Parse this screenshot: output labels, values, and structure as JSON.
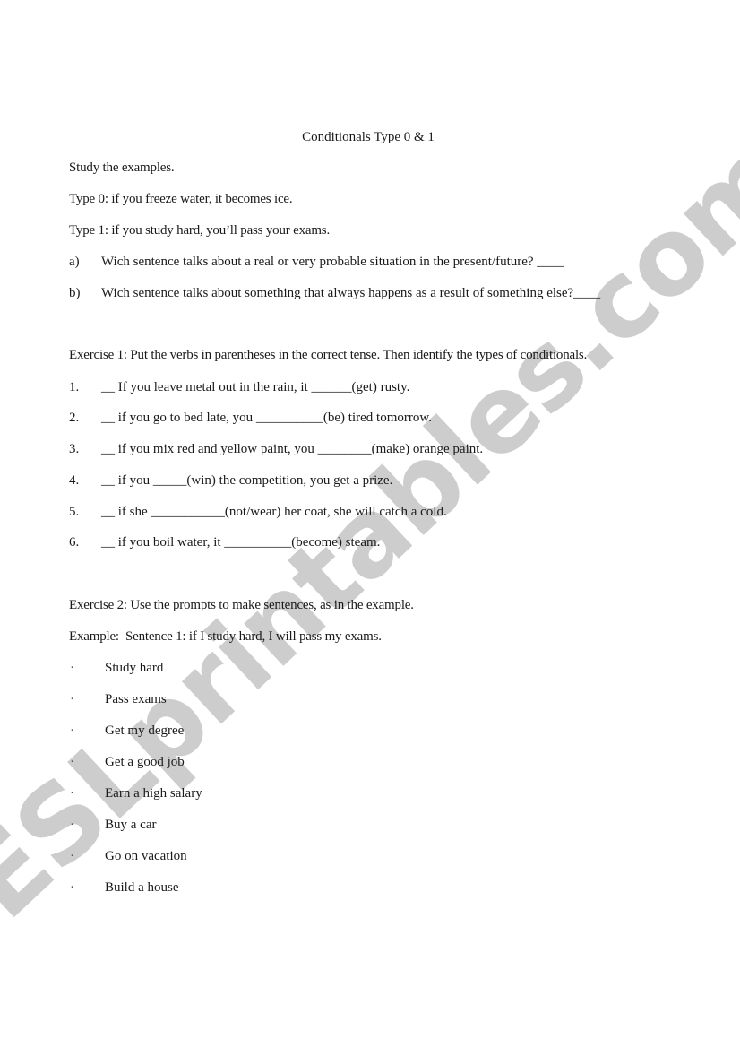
{
  "watermark": "ESLprintables.com",
  "title": "Conditionals Type 0 & 1",
  "intro": {
    "instruction": "Study the examples.",
    "type0": "Type 0: if you freeze water, it becomes ice.",
    "type1": "Type 1: if you study hard, you’ll pass your exams."
  },
  "questions": [
    {
      "label": "a)",
      "text": "Wich sentence talks about a real or very probable situation in the present/future? ____"
    },
    {
      "label": "b)",
      "text": "Wich sentence talks about something that always happens as a result of something else?____"
    }
  ],
  "exercise1": {
    "heading": "Exercise 1: Put the verbs in parentheses in the correct tense. Then identify the types of conditionals.",
    "items": [
      {
        "num": "1.",
        "text": "__ If you leave metal out in the rain, it ______(get) rusty."
      },
      {
        "num": "2.",
        "text": "__ if you go to bed late, you __________(be) tired tomorrow."
      },
      {
        "num": "3.",
        "text": "__ if you mix red and yellow paint, you ________(make) orange paint."
      },
      {
        "num": "4.",
        "text": "__ if you _____(win) the competition, you get a prize."
      },
      {
        "num": "5.",
        "text": "__ if she ___________(not/wear) her coat, she will catch a cold."
      },
      {
        "num": "6.",
        "text": "__ if you boil water, it __________(become) steam."
      }
    ]
  },
  "exercise2": {
    "heading": "Exercise 2: Use the prompts to make sentences, as in the example.",
    "example": "Example:  Sentence 1: if I study hard, I will pass my exams.",
    "bullet_symbol": "·",
    "prompts": [
      "Study hard",
      "Pass exams",
      "Get my degree",
      "Get a good job",
      "Earn a high salary",
      "Buy a car",
      "Go on vacation",
      "Build a house"
    ]
  }
}
